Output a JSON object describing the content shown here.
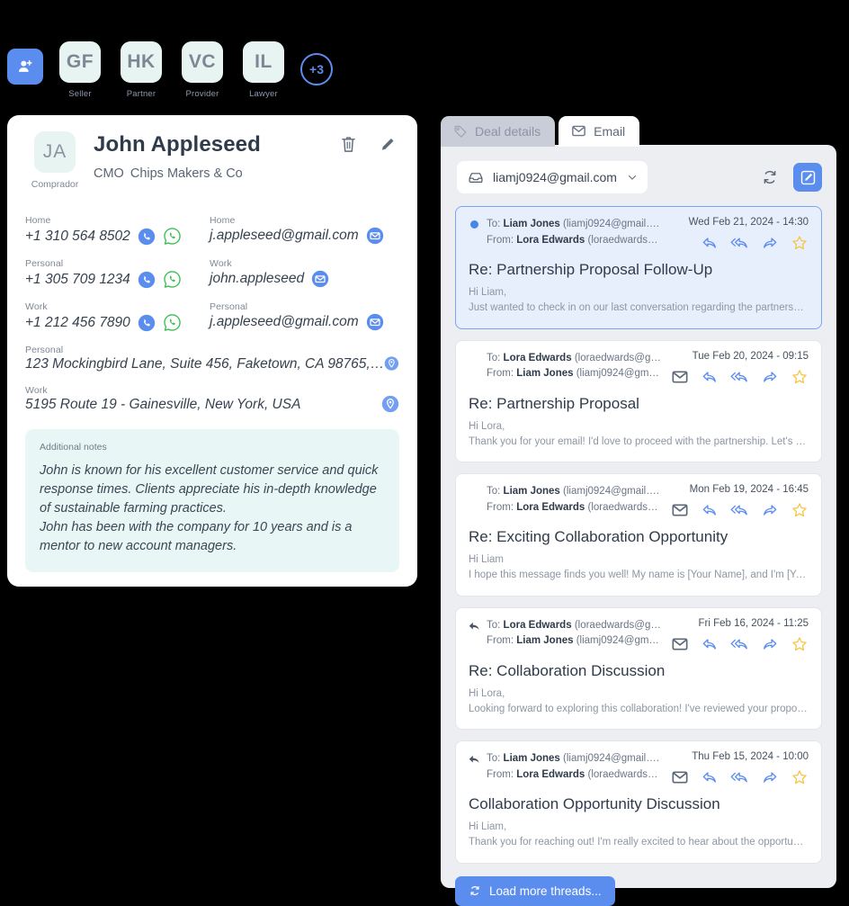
{
  "avatar_strip": {
    "add_button_icon": "person-add-icon",
    "contacts": [
      {
        "initials": "GF",
        "role": "Seller"
      },
      {
        "initials": "HK",
        "role": "Partner"
      },
      {
        "initials": "VC",
        "role": "Provider"
      },
      {
        "initials": "IL",
        "role": "Lawyer"
      }
    ],
    "more_label": "+3"
  },
  "contact_card": {
    "avatar_initials": "JA",
    "avatar_role": "Comprador",
    "name": "John  Appleseed",
    "job_title": "CMO",
    "company": "Chips Makers & Co",
    "delete_icon": "trash-icon",
    "edit_icon": "pencil-icon",
    "phones": [
      {
        "label": "Home",
        "value": "+1 310 564 8502"
      },
      {
        "label": "Personal",
        "value": "+1 305 709 1234"
      },
      {
        "label": "Work",
        "value": "+1 212 456 7890"
      }
    ],
    "emails": [
      {
        "label": "Home",
        "value": "j.appleseed@gmail.com"
      },
      {
        "label": "Work",
        "value": "john.appleseed"
      },
      {
        "label": "Personal",
        "value": "j.appleseed@gmail.com"
      }
    ],
    "addresses": [
      {
        "label": "Personal",
        "value": "123 Mockingbird Lane, Suite 456, Faketown, CA 98765,…"
      },
      {
        "label": "Work",
        "value": "5195 Route 19 - Gainesville, New York, USA"
      }
    ],
    "notes_label": "Additional notes",
    "notes_text": "John is known for his excellent customer service and quick response times. Clients appreciate his in-depth knowledge of sustainable farming practices.\nJohn has been with the company for 10 years and is a mentor to new account managers."
  },
  "tabs": [
    {
      "label": "Deal details",
      "icon": "tag-icon",
      "active": false
    },
    {
      "label": "Email",
      "icon": "envelope-icon",
      "active": true
    }
  ],
  "email_toolbar": {
    "account": "liamj0924@gmail.com",
    "inbox_icon": "inbox-icon",
    "chevron_icon": "chevron-down-icon",
    "refresh_icon": "refresh-icon",
    "compose_icon": "compose-icon"
  },
  "threads": [
    {
      "selected": true,
      "unread": true,
      "replied": false,
      "to_label": "To:",
      "to_name": "Liam Jones",
      "to_email": "(liamj0924@gmail….",
      "from_label": "From:",
      "from_name": "Lora Edwards",
      "from_email": "(loraedwards…",
      "date": "Wed Feb 21, 2024 - 14:30",
      "subject": "Re: Partnership Proposal Follow-Up",
      "snippet_line1": "Hi Liam,",
      "snippet_line2": "Just wanted to check in on our last conversation regarding the partnership. I thin…",
      "show_mail_icon": false
    },
    {
      "selected": false,
      "unread": false,
      "replied": false,
      "to_label": "To:",
      "to_name": "Lora Edwards",
      "to_email": "(loraedwards@g…",
      "from_label": "From:",
      "from_name": "Liam Jones",
      "from_email": "(liamj0924@gm…",
      "date": "Tue Feb 20, 2024 - 09:15",
      "subject": "Re: Partnership Proposal",
      "snippet_line1": "Hi Lora,",
      "snippet_line2": "Thank you for your email! I'd love to proceed with the partnership. Let's set up a…",
      "show_mail_icon": true
    },
    {
      "selected": false,
      "unread": false,
      "replied": false,
      "to_label": "To:",
      "to_name": "Liam Jones",
      "to_email": "(liamj0924@gmail….",
      "from_label": "From:",
      "from_name": "Lora Edwards",
      "from_email": "(loraedwards…",
      "date": "Mon Feb 19, 2024 - 16:45",
      "subject": "Re: Exciting Collaboration Opportunity",
      "snippet_line1": "Hi Liam",
      "snippet_line2": "I hope this message finds you well! My name is [Your Name], and I'm [Your Title]…",
      "show_mail_icon": true
    },
    {
      "selected": false,
      "unread": false,
      "replied": true,
      "to_label": "To:",
      "to_name": "Lora Edwards",
      "to_email": "(loraedwards@g…",
      "from_label": "From:",
      "from_name": "Liam Jones",
      "from_email": "(liamj0924@gm…",
      "date": "Fri Feb 16, 2024 - 11:25",
      "subject": "Re: Collaboration Discussion",
      "snippet_line1": "Hi Lora,",
      "snippet_line2": "Looking forward to exploring this collaboration! I've reviewed your proposal, and…",
      "show_mail_icon": true
    },
    {
      "selected": false,
      "unread": false,
      "replied": true,
      "to_label": "To:",
      "to_name": "Liam Jones",
      "to_email": "(liamj0924@gmail….",
      "from_label": "From:",
      "from_name": "Lora Edwards",
      "from_email": "(loraedwards…",
      "date": "Thu Feb 15, 2024 - 10:00",
      "subject": "Collaboration Opportunity Discussion",
      "snippet_line1": "Hi Liam,",
      "snippet_line2": "Thank you for reaching out! I'm really excited to hear about the opportunity to co…",
      "show_mail_icon": true
    }
  ],
  "load_more": {
    "label": "Load more threads...",
    "icon": "refresh-icon"
  },
  "colors": {
    "accent_blue": "#5b8def",
    "avatar_mint": "#e8f4f2",
    "notes_mint": "#e8f7f5",
    "whatsapp_green": "#3bbf53",
    "panel_gray": "#eceef2",
    "star_yellow": "#f5c64a"
  }
}
